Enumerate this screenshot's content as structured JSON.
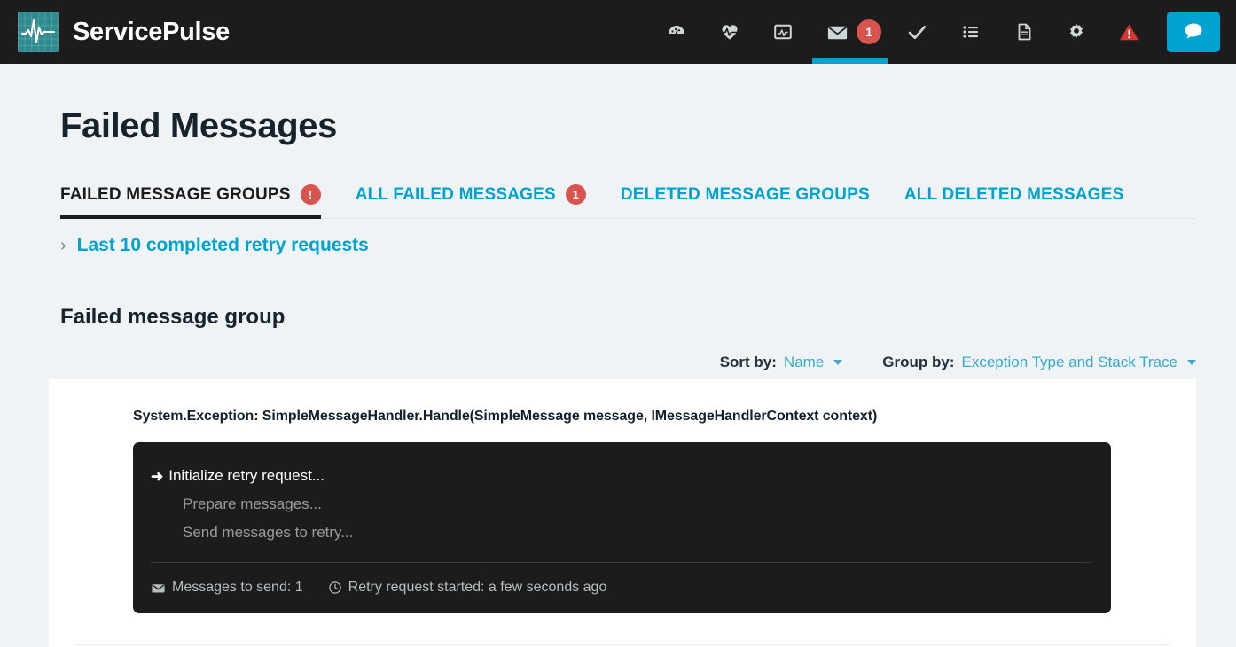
{
  "header": {
    "brand": "ServicePulse",
    "logo_icon": "pulse-waveform-logo",
    "accent_color": "#00a3d0",
    "background_color": "#1c1c1c",
    "nav_items": [
      {
        "icon": "dashboard-gauge-icon",
        "active": false,
        "badge": null
      },
      {
        "icon": "heartbeat-icon",
        "active": false,
        "badge": null
      },
      {
        "icon": "monitoring-chart-icon",
        "active": false,
        "badge": null
      },
      {
        "icon": "envelope-icon",
        "active": true,
        "badge": "1"
      },
      {
        "icon": "checkmark-icon",
        "active": false,
        "badge": null
      },
      {
        "icon": "list-icon",
        "active": false,
        "badge": null
      },
      {
        "icon": "document-icon",
        "active": false,
        "badge": null
      },
      {
        "icon": "gear-icon",
        "active": false,
        "badge": null
      },
      {
        "icon": "warning-triangle-icon",
        "active": false,
        "badge": null
      }
    ],
    "chat_button_icon": "speech-bubble-icon"
  },
  "page": {
    "title": "Failed Messages"
  },
  "tabs": [
    {
      "label": "FAILED MESSAGE GROUPS",
      "badge": "!",
      "active": true
    },
    {
      "label": "ALL FAILED MESSAGES",
      "badge": "1",
      "active": false
    },
    {
      "label": "DELETED MESSAGE GROUPS",
      "badge": null,
      "active": false
    },
    {
      "label": "ALL DELETED MESSAGES",
      "badge": null,
      "active": false
    }
  ],
  "retry_requests_link": {
    "label": "Last 10 completed retry requests",
    "chevron": "›"
  },
  "section": {
    "title": "Failed message group"
  },
  "controls": {
    "sort_by_label": "Sort by:",
    "sort_by_value": "Name",
    "group_by_label": "Group by:",
    "group_by_value": "Exception Type and Stack Trace"
  },
  "group": {
    "exception_title": "System.Exception: SimpleMessageHandler.Handle(SimpleMessage message, IMessageHandlerContext context)",
    "retry_panel": {
      "steps": [
        {
          "label": "Initialize retry request...",
          "state": "current",
          "arrow": "➜"
        },
        {
          "label": "Prepare messages...",
          "state": "pending"
        },
        {
          "label": "Send messages to retry...",
          "state": "pending"
        }
      ],
      "footer": {
        "messages_to_send": "Messages to send: 1",
        "messages_icon": "envelope-icon",
        "retry_started": "Retry request started: a few seconds ago",
        "clock_icon": "clock-icon"
      }
    }
  }
}
